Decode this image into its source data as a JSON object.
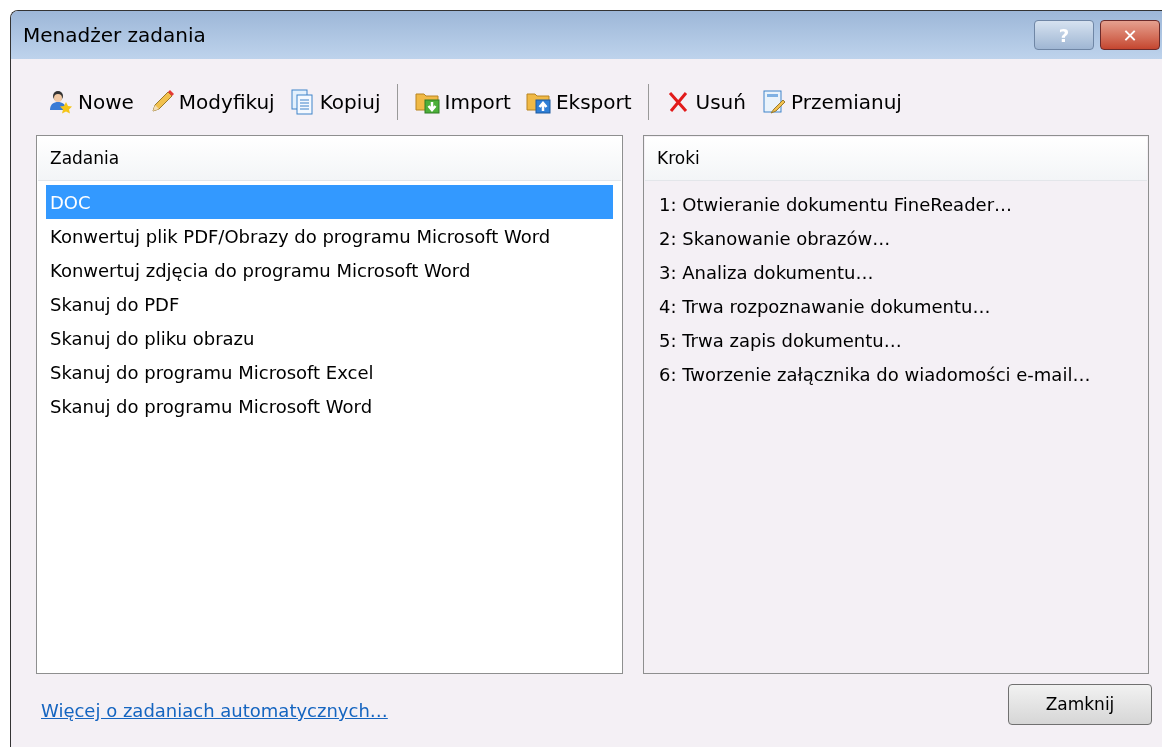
{
  "window": {
    "title": "Menadżer zadania",
    "help": "?",
    "close": "✕"
  },
  "toolbar": [
    {
      "kind": "user",
      "label": "Nowe"
    },
    {
      "kind": "pencil",
      "label": "Modyfikuj"
    },
    {
      "kind": "copy",
      "label": "Kopiuj"
    },
    {
      "kind": "separator"
    },
    {
      "kind": "import",
      "label": "Import"
    },
    {
      "kind": "export",
      "label": "Eksport"
    },
    {
      "kind": "separator"
    },
    {
      "kind": "delete",
      "label": "Usuń"
    },
    {
      "kind": "rename",
      "label": "Przemianuj"
    }
  ],
  "tasks": {
    "header": "Zadania",
    "items": [
      {
        "label": "DOC",
        "selected": true
      },
      {
        "label": "Konwertuj plik PDF/Obrazy do programu Microsoft Word",
        "selected": false
      },
      {
        "label": "Konwertuj zdjęcia do programu Microsoft Word",
        "selected": false
      },
      {
        "label": "Skanuj do PDF",
        "selected": false
      },
      {
        "label": "Skanuj do pliku obrazu",
        "selected": false
      },
      {
        "label": "Skanuj do programu Microsoft Excel",
        "selected": false
      },
      {
        "label": "Skanuj do programu Microsoft Word",
        "selected": false
      }
    ]
  },
  "steps": {
    "header": "Kroki",
    "items": [
      "1: Otwieranie dokumentu FineReader…",
      "2: Skanowanie obrazów…",
      "3: Analiza dokumentu…",
      "4: Trwa rozpoznawanie dokumentu…",
      "5: Trwa zapis dokumentu…",
      "6: Tworzenie załącznika do wiadomości e-mail…"
    ]
  },
  "link": "Więcej o zadaniach automatycznych…",
  "close_button": "Zamknij"
}
